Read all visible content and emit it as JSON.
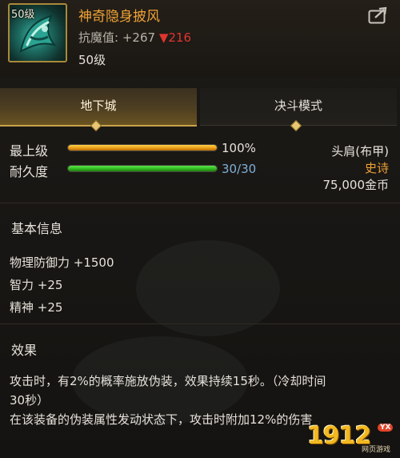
{
  "item": {
    "level_badge": "50级",
    "name": "神奇隐身披风",
    "resist_label": "抗魔值:",
    "resist_value": "+267",
    "resist_diff": "▼216",
    "level": "50级"
  },
  "icons": {
    "share": "share-icon",
    "item": "cloak-item-icon",
    "tab_marker": "diamond-icon"
  },
  "tabs": [
    {
      "label": "地下城",
      "active": true
    },
    {
      "label": "决斗模式",
      "active": false
    }
  ],
  "stats": {
    "grade_label": "最上级",
    "grade_value": "100%",
    "grade_fraction": 1.0,
    "durability_label": "耐久度",
    "durability_value": "30/30",
    "durability_fraction": 1.0
  },
  "meta": {
    "slot": "头肩(布甲)",
    "rarity": "史诗",
    "price": "75,000金币"
  },
  "basic_info": {
    "title": "基本信息",
    "attrs": [
      "物理防御力 +1500",
      "智力 +25",
      "精神 +25"
    ]
  },
  "effect": {
    "title": "效果",
    "lines": [
      "攻击时，有2%的概率施放伪装，效果持续15秒。（冷却时间",
      "30秒）",
      "在该装备的伪装属性发动状态下，攻击时附加12%的伤害"
    ]
  },
  "logo": {
    "number": "1912",
    "badge": "YX",
    "subtitle": "网页游戏"
  },
  "colors": {
    "epic": "#f0a236",
    "down": "#e0352f",
    "durability_green": "#2fb31e",
    "grade_orange": "#e79a14",
    "durability_text": "#7fb0d8"
  }
}
